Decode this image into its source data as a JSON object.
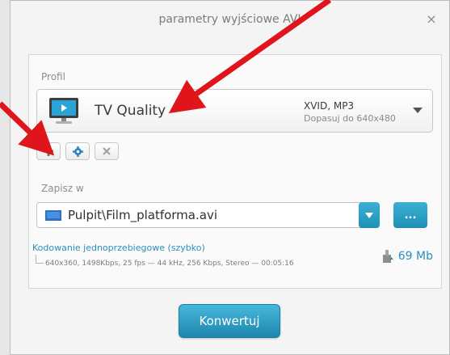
{
  "dialog": {
    "title": "parametry wyjściowe AVI",
    "close_glyph": "×"
  },
  "profile": {
    "section_label": "Profil",
    "name": "TV Quality",
    "codec": "XVID, MP3",
    "fit": "Dopasuj do 640x480",
    "icon": "tv-icon"
  },
  "profile_actions": {
    "add_icon": "plus-icon",
    "settings_icon": "gear-icon",
    "delete_icon": "close-icon"
  },
  "save": {
    "section_label": "Zapisz w",
    "path": "Pulpit\\Film_platforma.avi",
    "browse_label": "..."
  },
  "encoding": {
    "mode_link": "Kodowanie jednoprzebiegowe (szybko)",
    "details": "640x360, 1498Kbps, 25 fps — 44 kHz, 256 Kbps, Stereo — 00:05:16",
    "size": "69 Mb"
  },
  "convert_button": "Konwertuj",
  "colors": {
    "accent": "#2a8fbf",
    "button": "#1f8fb6",
    "annotation_arrow": "#e0141b",
    "add_green": "#3f9a2e"
  }
}
